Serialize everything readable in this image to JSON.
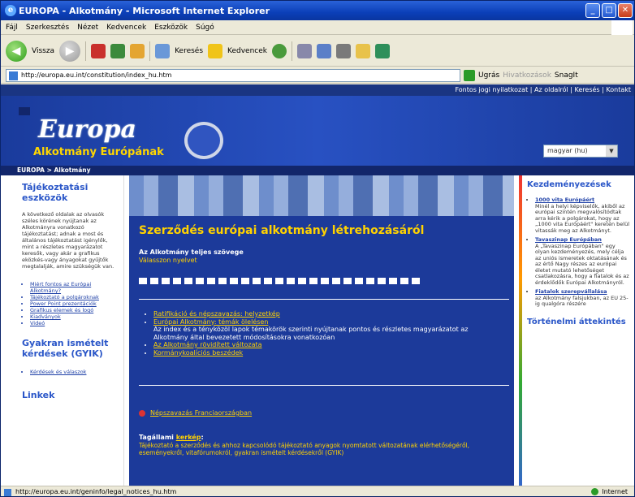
{
  "window": {
    "title": "EUROPA - Alkotmány - Microsoft Internet Explorer"
  },
  "menu": [
    "Fájl",
    "Szerkesztés",
    "Nézet",
    "Kedvencek",
    "Eszközök",
    "Súgó"
  ],
  "toolbar": {
    "back": "Vissza",
    "search": "Keresés",
    "favorites": "Kedvencek"
  },
  "address": {
    "url": "http://europa.eu.int/constitution/index_hu.htm",
    "go": "Ugrás",
    "links": "Hivatkozások",
    "snagit": "SnagIt"
  },
  "site": {
    "toplinks": "Fontos jogi nyilatkozat | Az oldalról | Keresés | Kontakt",
    "brand": "Europa",
    "subbrand": "Alkotmány Európának",
    "lang_select": "magyar (hu)",
    "breadcrumb": "EUROPA > Alkotmány"
  },
  "left": {
    "heading1": "Tájékoztatási eszközök",
    "text1": "A következő oldalak az olvasók széles körének nyújtanak az Alkotmányra vonatkozó tájékoztatást; adnak a most és általános tájékoztatást igénylők, mint a részletes magyarázatot keresők, vagy akár a grafikus eközkés-vagy ányagokat gyűjtők megtalalják, amire szükségük van.",
    "links1": [
      "Miért fontos az Európai Alkotmány?",
      "Tájékoztató a polgároknak",
      "Power Point prezentációk",
      "Grafikus elemek és logó",
      "Kiadványok",
      "Videó"
    ],
    "heading2": "Gyakran ismételt kérdések (GYIK)",
    "links2": [
      "Kérdések és válaszok"
    ],
    "heading3": "Linkek"
  },
  "center": {
    "title": "Szerződés európai alkotmány létrehozásáról",
    "full_text": "Az Alkotmány teljes szövege",
    "choose": "Válasszon nyelvet",
    "links": [
      {
        "label": "Ratifikáció és népszavazás: helyzetkép"
      },
      {
        "label": "Európai Alkotmány: témák ölelésen",
        "desc": "Az index és a tényközöl lapok témakörök szerinti nyújtanak pontos és részletes magyarázatot az Alkotmány által bevezetett módosításokra vonatkozóan"
      },
      {
        "label": "Az Alkotmány rövidített változata"
      },
      {
        "label": "Kormánykoalíciós beszédek"
      }
    ],
    "news": "Népszavazás Franciaországban",
    "state_prefix": "Tagállami",
    "state_link": "kerkép",
    "state_text": "Tájékoztató a szerződés és ahhoz kapcsolódó tájékoztató anyagok nyomtatott változatának elérhetőségéről, eseményekről, vitafórumokról, gyakran ismételt kérdésekről (GYIK)"
  },
  "right": {
    "heading1": "Kezdeményezések",
    "items": [
      {
        "link": "1000 vita Európáért",
        "text": "Minél a helyi képviselők, akiből az európai szintén megvalósítódtak arra kérik a polgárokat, hogy az „1000 vita Európáért\" keretén belül vitassák meg az Alkotmányt."
      },
      {
        "link": "Tavaszinap Európában",
        "text": "A „Tavaszinap Európában\" egy olyan kezdeményezés, mely célja az uniós ismeretek oktatásának és az értő Nagy részes az európai életet mutató lehetőséget csatlakozásra, hogy a fiatalok és az érdeklődők Európai Alkotmányról."
      },
      {
        "link": "Fiatalok szerepvállalása",
        "text": "az Alkotmány falsjukban, az EU 25-ig qualgóra részére"
      }
    ],
    "heading2": "Történelmi áttekintés"
  },
  "status": {
    "url": "http://europa.eu.int/geninfo/legal_notices_hu.htm",
    "zone": "Internet"
  }
}
